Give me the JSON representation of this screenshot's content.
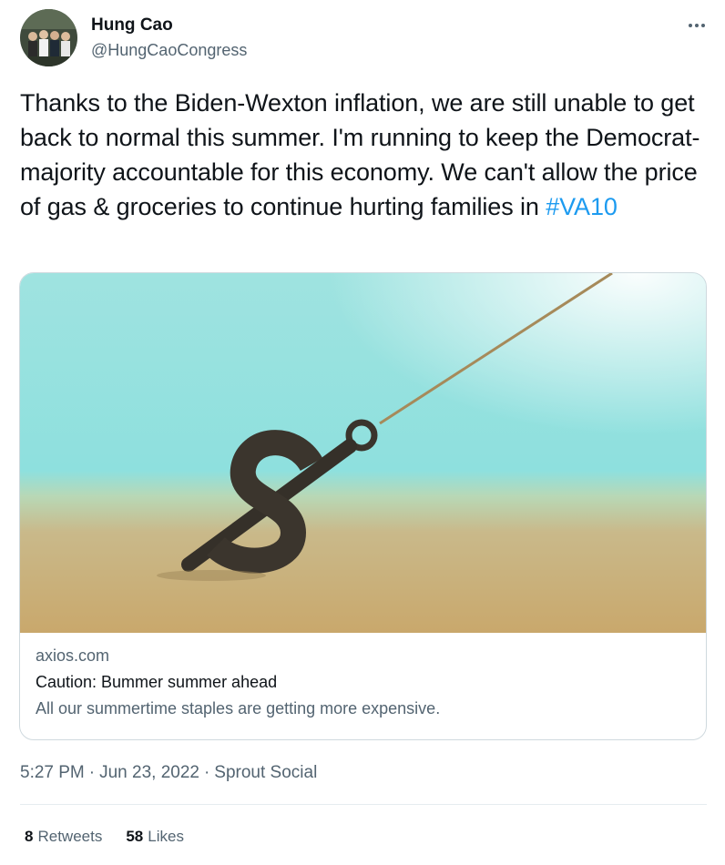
{
  "author": {
    "display_name": "Hung Cao",
    "handle": "@HungCaoCongress",
    "avatar_icon": "family-photo-avatar"
  },
  "tweet": {
    "text": "Thanks to the Biden-Wexton inflation, we are still unable to get back to normal this summer. I'm running to keep the Democrat-majority accountable for this economy. We can't allow the price of gas & groceries to continue hurting families in ",
    "hashtag": "#VA10"
  },
  "card": {
    "domain": "axios.com",
    "title": "Caution: Bummer summer ahead",
    "description": "All our summertime staples are getting more expensive.",
    "image_icon": "dollar-sign-anchor-illustration"
  },
  "meta": {
    "time": "5:27 PM",
    "date": "Jun 23, 2022",
    "source": "Sprout Social",
    "separator": "·"
  },
  "stats": {
    "retweets_count": "8",
    "retweets_label": "Retweets",
    "likes_count": "58",
    "likes_label": "Likes"
  },
  "colors": {
    "link": "#1d9bf0",
    "secondary_text": "#536471",
    "primary_text": "#0f1419",
    "border": "#cfd9de"
  }
}
